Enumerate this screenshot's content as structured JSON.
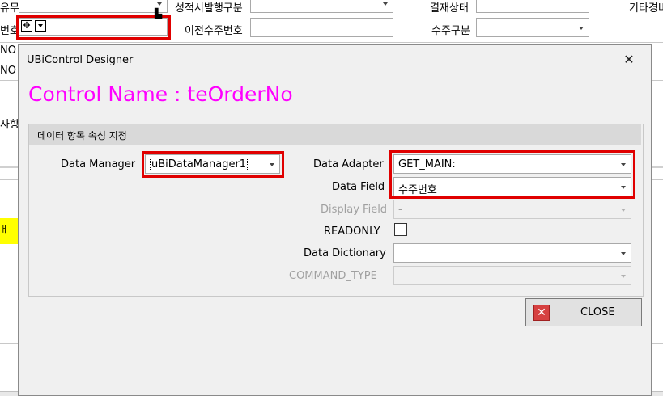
{
  "background": {
    "row1": {
      "label_left": "유무",
      "label_mid": "성적서발행구분",
      "label_status": "결재상태",
      "label_right": "기타경비"
    },
    "row2": {
      "label_left": "번호",
      "label_prev_order": "이전수주번호",
      "label_order_type": "수주구분"
    },
    "row3": {
      "label_left": "NO"
    },
    "row4": {
      "label_left": "NO"
    },
    "row5": {
      "label_left": "사항"
    },
    "row6": {
      "label_left": "ㅐ"
    }
  },
  "dialog": {
    "title": "UBiControl Designer",
    "close_glyph": "✕",
    "control_name": "Control Name : teOrderNo",
    "group_title": "데이터 항목 속성 지정",
    "fields": {
      "data_manager": {
        "label": "Data Manager",
        "value": "uBiDataManager1"
      },
      "data_adapter": {
        "label": "Data Adapter",
        "value": "GET_MAIN:"
      },
      "data_field": {
        "label": "Data Field",
        "value": "수주번호"
      },
      "display_field": {
        "label": "Display Field",
        "value": "-"
      },
      "readonly": {
        "label": "READONLY",
        "checked": false
      },
      "data_dictionary": {
        "label": "Data Dictionary",
        "value": ""
      },
      "command_type": {
        "label": "COMMAND_TYPE",
        "value": ""
      }
    },
    "close_button": {
      "label": "CLOSE",
      "icon": "close-x-icon"
    }
  },
  "colors": {
    "highlight": "#e00000",
    "control_name": "#ff00ff",
    "dialog_bg": "#f0f0f0"
  }
}
